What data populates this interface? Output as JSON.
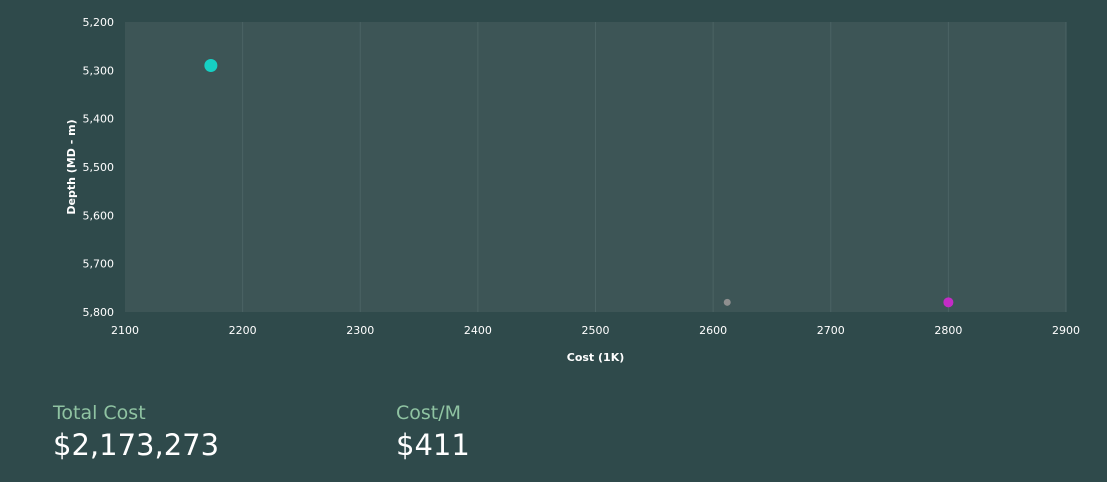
{
  "chart_data": {
    "type": "scatter",
    "xlabel": "Cost (1K)",
    "ylabel": "Depth (MD - m)",
    "xlim": [
      2100,
      2900
    ],
    "ylim": [
      5200,
      5800
    ],
    "y_inverted": true,
    "x_ticks": [
      "2100",
      "2200",
      "2300",
      "2400",
      "2500",
      "2600",
      "2700",
      "2800",
      "2900"
    ],
    "y_ticks": [
      "5,200",
      "5,300",
      "5,400",
      "5,500",
      "5,600",
      "5,700",
      "5,800"
    ],
    "grid": "vertical",
    "points": [
      {
        "x": 2173,
        "y": 5290,
        "color": "#16d0c4",
        "size": "large"
      },
      {
        "x": 2612,
        "y": 5780,
        "color": "#8f8f8f",
        "size": "small"
      },
      {
        "x": 2800,
        "y": 5780,
        "color": "#c42bc6",
        "size": "medium"
      }
    ]
  },
  "metrics": {
    "total_cost": {
      "label": "Total Cost",
      "value": "$2,173,273"
    },
    "cost_per_m": {
      "label": "Cost/M",
      "value": "$411"
    }
  }
}
